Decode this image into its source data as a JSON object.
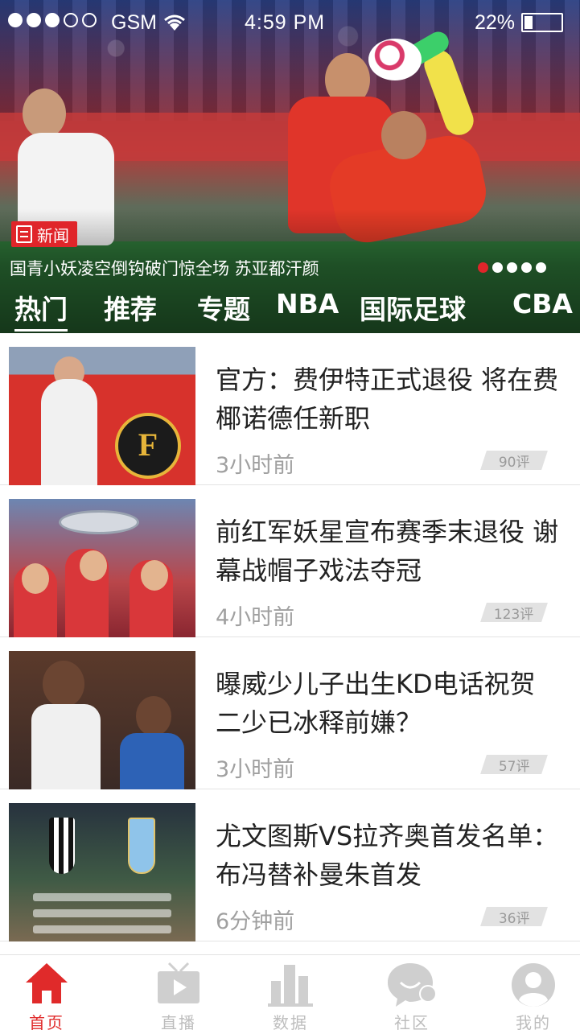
{
  "status_bar": {
    "signal_filled": 3,
    "signal_total": 5,
    "carrier": "GSM",
    "time": "4:59  PM",
    "battery_percent": "22%",
    "battery_level": 0.22
  },
  "hero": {
    "badge": "新闻",
    "headline": "国青小妖凌空倒钩破门惊全场 苏亚都汗颜",
    "slide_count": 5,
    "active_slide": 0
  },
  "tabs": [
    {
      "label": "热门",
      "active": true
    },
    {
      "label": "推荐",
      "active": false
    },
    {
      "label": "专题",
      "active": false
    },
    {
      "label": "NBA",
      "active": false
    },
    {
      "label": "国际足球",
      "active": false
    },
    {
      "label": "CBA",
      "active": false
    }
  ],
  "news": [
    {
      "title": "官方：费伊特正式退役 将在费椰诺德任新职",
      "time": "3小时前",
      "comments": "90评"
    },
    {
      "title": "前红军妖星宣布赛季末退役 谢幕战帽子戏法夺冠",
      "time": "4小时前",
      "comments": "123评"
    },
    {
      "title": "曝威少儿子出生KD电话祝贺 二少已冰释前嫌？",
      "time": "3小时前",
      "comments": "57评"
    },
    {
      "title": "尤文图斯VS拉齐奥首发名单：布冯替补曼朱首发",
      "time": "6分钟前",
      "comments": "36评"
    }
  ],
  "bottom_nav": [
    {
      "label": "首页",
      "icon": "home-icon",
      "active": true
    },
    {
      "label": "直播",
      "icon": "tv-play-icon",
      "active": false
    },
    {
      "label": "数据",
      "icon": "bar-chart-icon",
      "active": false
    },
    {
      "label": "社区",
      "icon": "chat-bubble-icon",
      "active": false
    },
    {
      "label": "我的",
      "icon": "user-avatar-icon",
      "active": false
    }
  ],
  "colors": {
    "accent": "#e02a2a",
    "inactive": "#bdbdbd",
    "text": "#222222",
    "meta": "#a0a0a0"
  }
}
